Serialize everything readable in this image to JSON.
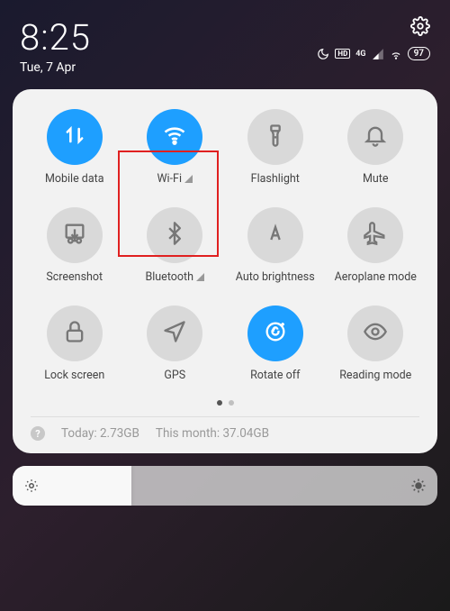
{
  "clock": {
    "time": "8:25",
    "date": "Tue, 7 Apr"
  },
  "status": {
    "network": "4G",
    "battery": "97"
  },
  "tiles": [
    {
      "label": "Mobile data"
    },
    {
      "label": "Wi-Fi"
    },
    {
      "label": "Flashlight"
    },
    {
      "label": "Mute"
    },
    {
      "label": "Screenshot"
    },
    {
      "label": "Bluetooth"
    },
    {
      "label": "Auto brightness"
    },
    {
      "label": "Aeroplane mode"
    },
    {
      "label": "Lock screen"
    },
    {
      "label": "GPS"
    },
    {
      "label": "Rotate off"
    },
    {
      "label": "Reading mode"
    }
  ],
  "usage": {
    "today": "Today: 2.73GB",
    "month": "This month: 37.04GB"
  }
}
